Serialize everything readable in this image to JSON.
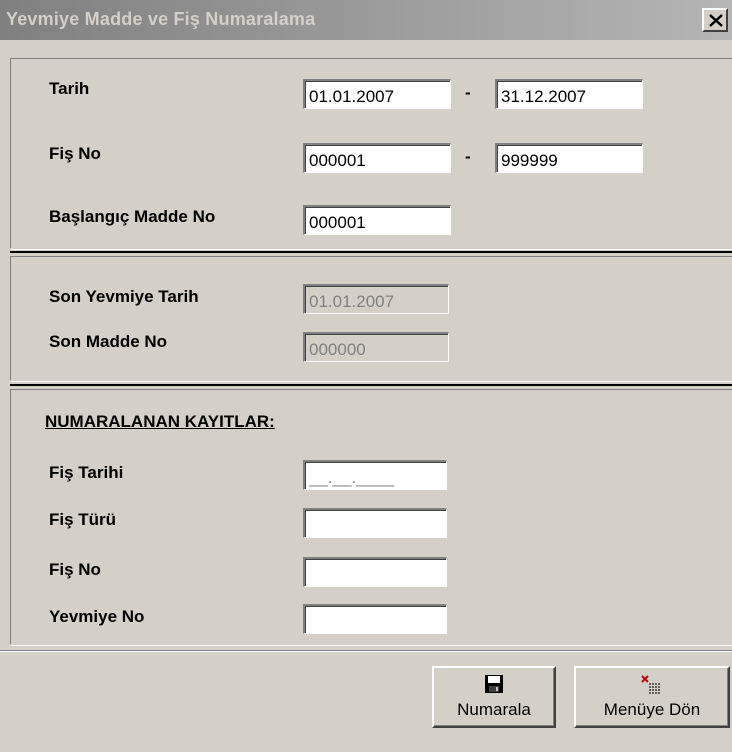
{
  "window": {
    "title": "Yevmiye Madde ve Fiş Numaralama"
  },
  "range": {
    "date_label": "Tarih",
    "date_from": "01.01.2007",
    "date_to": "31.12.2007",
    "fis_label": "Fiş No",
    "fis_from": "000001",
    "fis_to": "999999",
    "dash": "-",
    "start_madde_label": "Başlangıç Madde No",
    "start_madde_value": "000001"
  },
  "last": {
    "yevmiye_tarih_label": "Son Yevmiye Tarih",
    "yevmiye_tarih_value": "01.01.2007",
    "madde_label": "Son Madde No",
    "madde_value": "000000"
  },
  "numbered": {
    "heading": "NUMARALANAN KAYITLAR:",
    "fis_tarihi_label": "Fiş Tarihi",
    "fis_tarihi_value": "__.__.____",
    "fis_turu_label": "Fiş Türü",
    "fis_turu_value": "",
    "fis_no_label": "Fiş No",
    "fis_no_value": "",
    "yevmiye_no_label": "Yevmiye No",
    "yevmiye_no_value": ""
  },
  "buttons": {
    "numarala": "Numarala",
    "menuye_don": "Menüye Dön"
  },
  "icons": {
    "close": "close-icon",
    "numarala": "floppy-disk-icon",
    "menuye_don": "exit-menu-icon"
  }
}
